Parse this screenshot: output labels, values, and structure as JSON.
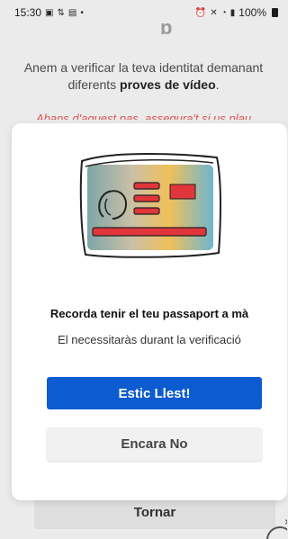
{
  "status_bar": {
    "time": "15:30",
    "battery": "100%",
    "left_icons": [
      "photo-icon",
      "data-icon",
      "cast-icon"
    ],
    "right_icons": [
      "alarm-icon",
      "mute-icon",
      "wifi-icon",
      "signal-icon",
      "battery-icon"
    ]
  },
  "background": {
    "intro_text_before": "Anem a verificar la teva identitat demanant diferents ",
    "intro_text_bold": "proves de vídeo",
    "intro_text_after": ".",
    "warning_text": "Abans d'aquest pas, assegura't si us plau",
    "back_button_label": "Tornar",
    "warning_color": "#d9534f"
  },
  "modal": {
    "title": "Recorda tenir el teu passaport a mà",
    "subtitle": "El necessitaràs durant la verificació",
    "primary_button_label": "Estic Llest!",
    "secondary_button_label": "Encara No",
    "primary_color": "#0c5bd0",
    "illustration": "passport-id-card-icon"
  }
}
